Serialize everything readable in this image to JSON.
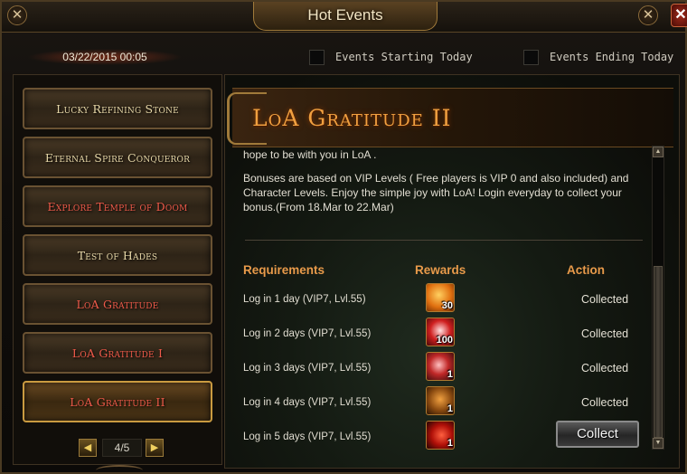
{
  "window": {
    "title": "Hot Events",
    "close_label": "✕",
    "corner_ornament": "✕"
  },
  "header": {
    "date": "03/22/2015 00:05",
    "filters": [
      {
        "label": "Events Starting Today",
        "checked": false
      },
      {
        "label": "Events Ending Today",
        "checked": false
      }
    ]
  },
  "sidebar": {
    "items": [
      {
        "label": "Lucky Refining Stone",
        "color": "gold"
      },
      {
        "label": "Eternal Spire Conqueror",
        "color": "gold"
      },
      {
        "label": "Explore Temple of Doom",
        "color": "red"
      },
      {
        "label": "Test of Hades",
        "color": "gold"
      },
      {
        "label": "LoA Gratitude",
        "color": "red"
      },
      {
        "label": "LoA Gratitude I",
        "color": "red"
      },
      {
        "label": "LoA Gratitude II",
        "color": "red",
        "active": true
      }
    ],
    "pager": {
      "prev": "◀",
      "page": "4/5",
      "next": "▶"
    }
  },
  "event": {
    "title": "LoA Gratitude II",
    "description": [
      "hope to be with you in LoA .",
      "Bonuses are based on VIP Levels ( Free players is VIP 0 and also included) and Character Levels. Enjoy the simple joy with LoA! Login everyday to collect your bonus.(From 18.Mar to 22.Mar)"
    ],
    "columns": {
      "requirements": "Requirements",
      "rewards": "Rewards",
      "action": "Action"
    },
    "rows": [
      {
        "requirement": "Log in 1 day (VIP7, Lvl.55)",
        "reward_icon": "gold-flame-icon",
        "reward_qty": "30",
        "action": "Collected"
      },
      {
        "requirement": "Log in 2 days  (VIP7, Lvl.55)",
        "reward_icon": "red-orb-icon",
        "reward_qty": "100",
        "action": "Collected"
      },
      {
        "requirement": "Log in 3 days (VIP7, Lvl.55)",
        "reward_icon": "red-crystal-icon",
        "reward_qty": "1",
        "action": "Collected"
      },
      {
        "requirement": "Log in 4 days (VIP7, Lvl.55)",
        "reward_icon": "bronze-chest-icon",
        "reward_qty": "1",
        "action": "Collected"
      },
      {
        "requirement": "Log in 5 days (VIP7, Lvl.55)",
        "reward_icon": "crimson-crescent-icon",
        "reward_qty": "1",
        "action": "Collect"
      }
    ],
    "scroll": {
      "up": "▲",
      "down": "▼"
    }
  },
  "colors": {
    "accent_orange": "#e89a4a",
    "title_orange": "#f0a040",
    "red_label": "#ef5a4a",
    "gold_label": "#e8d8a8"
  }
}
